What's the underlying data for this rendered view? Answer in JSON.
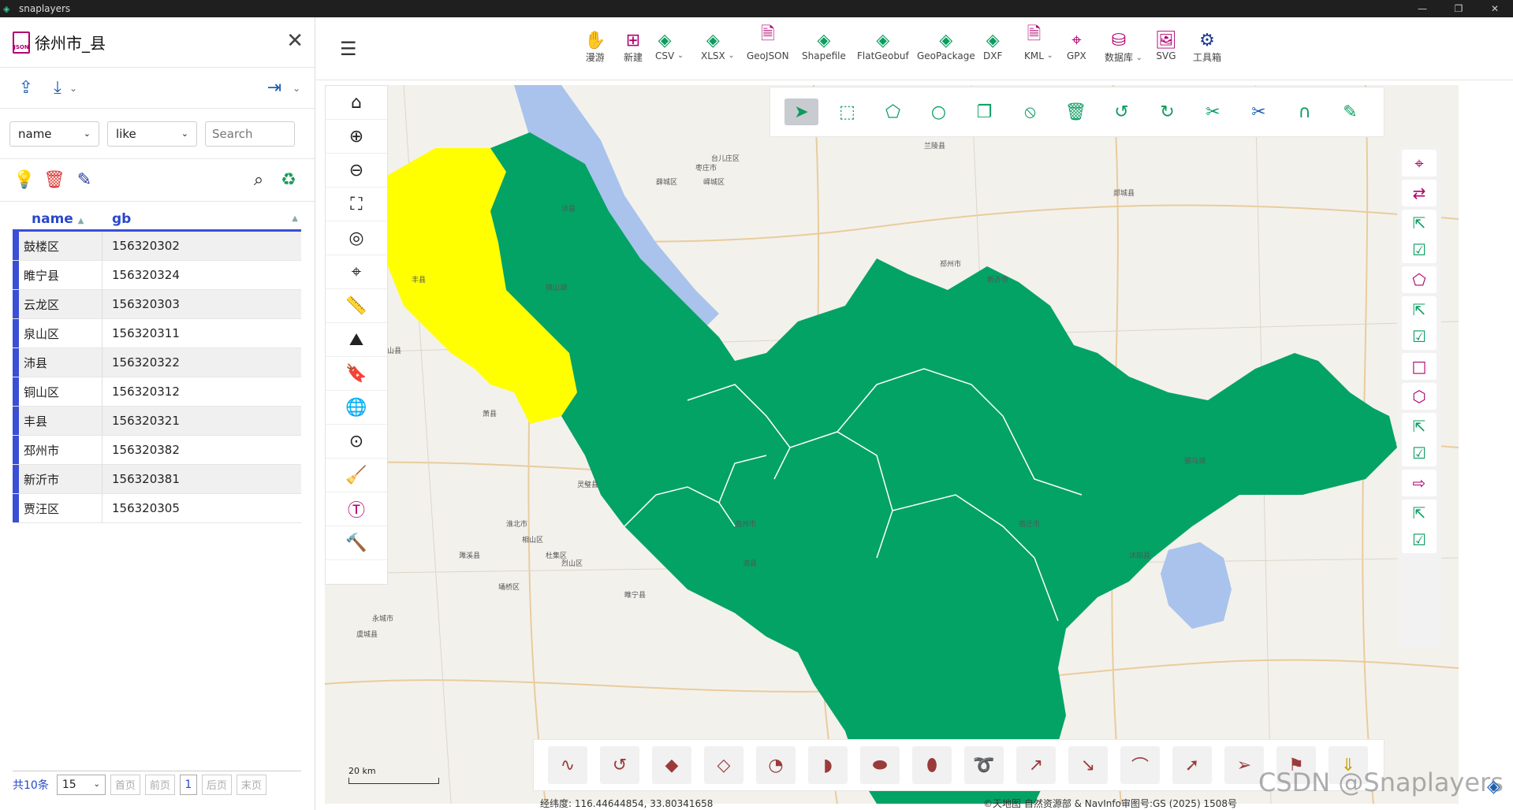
{
  "window": {
    "title": "snaplayers"
  },
  "panel": {
    "title": "徐州市_县",
    "filter": {
      "field": "name",
      "operator": "like",
      "search_placeholder": "Search"
    },
    "table": {
      "headers": [
        "name",
        "gb"
      ],
      "rows": [
        {
          "name": "鼓楼区",
          "gb": "156320302"
        },
        {
          "name": "睢宁县",
          "gb": "156320324"
        },
        {
          "name": "云龙区",
          "gb": "156320303"
        },
        {
          "name": "泉山区",
          "gb": "156320311"
        },
        {
          "name": "沛县",
          "gb": "156320322"
        },
        {
          "name": "铜山区",
          "gb": "156320312"
        },
        {
          "name": "丰县",
          "gb": "156320321"
        },
        {
          "name": "邳州市",
          "gb": "156320382"
        },
        {
          "name": "新沂市",
          "gb": "156320381"
        },
        {
          "name": "贾汪区",
          "gb": "156320305"
        }
      ]
    },
    "pager": {
      "total": "共10条",
      "page_size": "15",
      "first": "首页",
      "prev": "前页",
      "current": "1",
      "next": "后页",
      "last": "末页"
    }
  },
  "toolbar": {
    "tools": [
      {
        "label": "漫游",
        "icon": "hand-icon"
      },
      {
        "label": "新建",
        "icon": "new-file-icon"
      },
      {
        "label": "CSV",
        "icon": "layers-icon"
      },
      {
        "label": "XLSX",
        "icon": "layers-icon"
      },
      {
        "label": "GeoJSON",
        "icon": "json-file-icon"
      },
      {
        "label": "Shapefile",
        "icon": "layers-icon"
      },
      {
        "label": "FlatGeobuf",
        "icon": "layers-icon"
      },
      {
        "label": "GeoPackage",
        "icon": "layers-icon"
      },
      {
        "label": "DXF",
        "icon": "layers-icon"
      },
      {
        "label": "KML",
        "icon": "xml-file-icon"
      },
      {
        "label": "GPX",
        "icon": "map-pin-icon"
      },
      {
        "label": "数据库",
        "icon": "database-icon"
      },
      {
        "label": "SVG",
        "icon": "image-icon"
      },
      {
        "label": "工具箱",
        "icon": "gear-icon"
      }
    ]
  },
  "map": {
    "scale": "20 km",
    "coords": "经纬度:  116.44644854, 33.80341658",
    "attribution": "©天地图 自然资源部 & NavInfo审图号:GS (2025) 1508号",
    "watermark": "CSDN @Snaplayers",
    "colors": {
      "selected": "#ffff00",
      "features": "#03a366",
      "water": "#a9c3ec"
    },
    "places": [
      "台儿庄区",
      "枣庄市",
      "薛城区",
      "峄城区",
      "沛县",
      "丰县",
      "砀山县",
      "萧县",
      "宿州市",
      "淮北市",
      "灵璧县",
      "泗县",
      "睢宁县",
      "宿迁市",
      "沭阳县",
      "郯城县",
      "邳州市",
      "新沂市",
      "兰陵县",
      "微山湖",
      "骆马湖",
      "杜集区",
      "相山区",
      "烈山区",
      "埇桥区",
      "濉溪县",
      "永城市",
      "虞城县"
    ]
  }
}
